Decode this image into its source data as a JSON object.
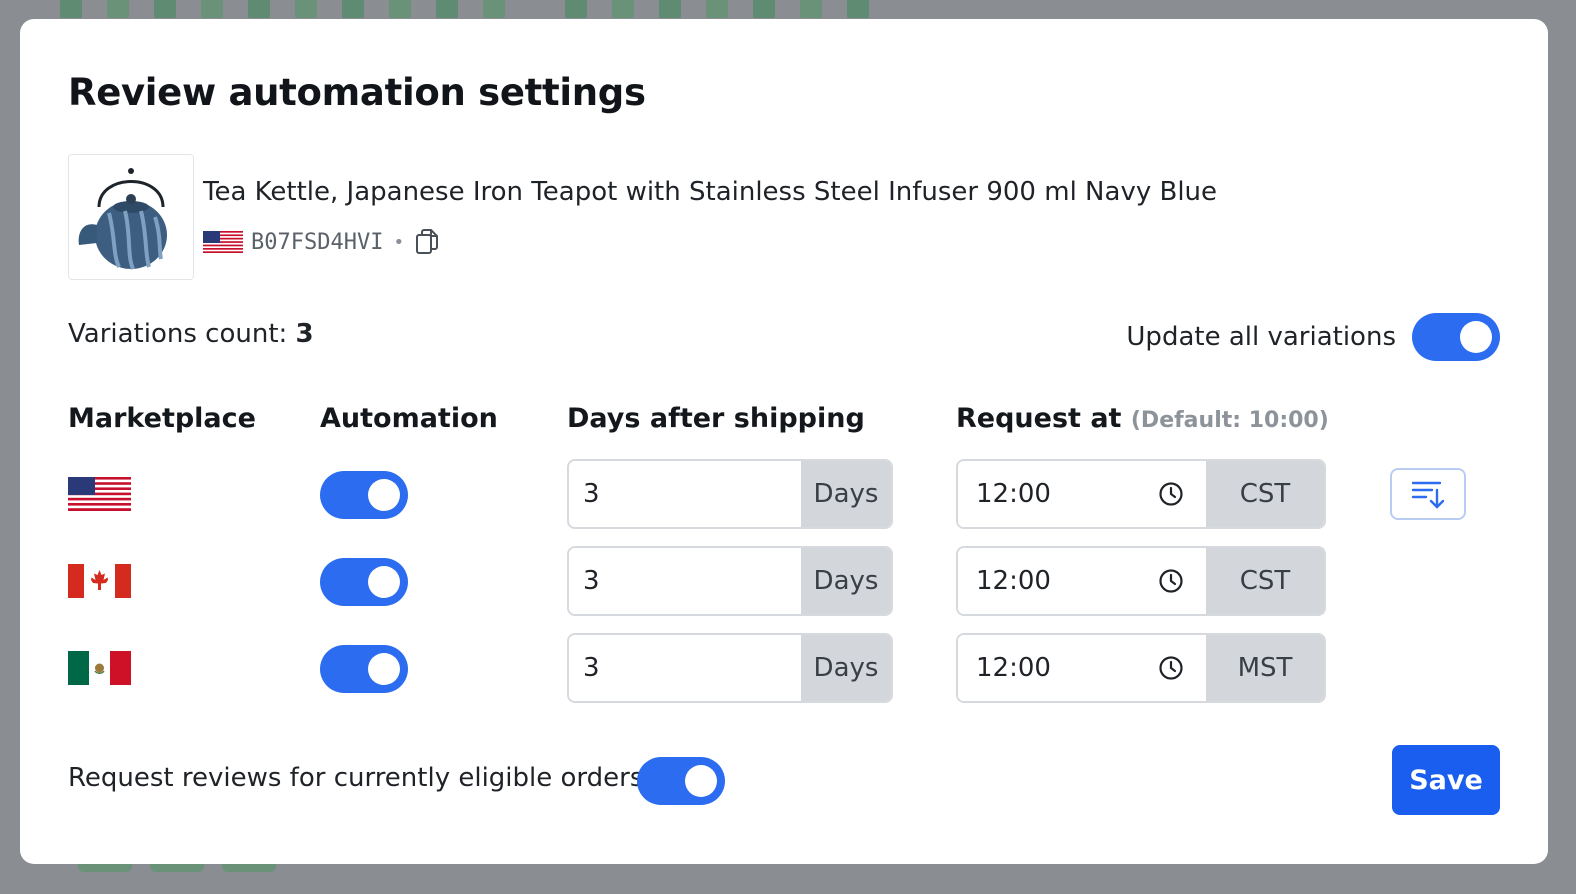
{
  "modal": {
    "title": "Review automation settings"
  },
  "product": {
    "name": "Tea Kettle, Japanese Iron Teapot with Stainless Steel Infuser 900 ml Navy Blue",
    "asin": "B07FSD4HVI",
    "separator": "•",
    "image_icon": "teapot-image",
    "flag_icon": "us-flag-icon",
    "copy_icon": "copy-icon"
  },
  "variations": {
    "label": "Variations count:",
    "count": "3",
    "update_all_label": "Update all variations",
    "update_all_on": true
  },
  "columns": {
    "marketplace": "Marketplace",
    "automation": "Automation",
    "days": "Days after shipping",
    "request_at": "Request at",
    "request_default": "(Default: 10:00)"
  },
  "rows": [
    {
      "flag_icon": "us-flag-icon",
      "automation_on": true,
      "days_value": "3",
      "days_unit": "Days",
      "time": "12:00",
      "timezone": "CST"
    },
    {
      "flag_icon": "ca-flag-icon",
      "automation_on": true,
      "days_value": "3",
      "days_unit": "Days",
      "time": "12:00",
      "timezone": "CST"
    },
    {
      "flag_icon": "mx-flag-icon",
      "automation_on": true,
      "days_value": "3",
      "days_unit": "Days",
      "time": "12:00",
      "timezone": "MST"
    }
  ],
  "footer": {
    "eligible_label": "Request reviews for currently eligible orders",
    "eligible_on": true,
    "save_label": "Save"
  },
  "colors": {
    "accent": "#2b6cf0",
    "save": "#1a5ef0",
    "addon": "#d3d6da"
  }
}
